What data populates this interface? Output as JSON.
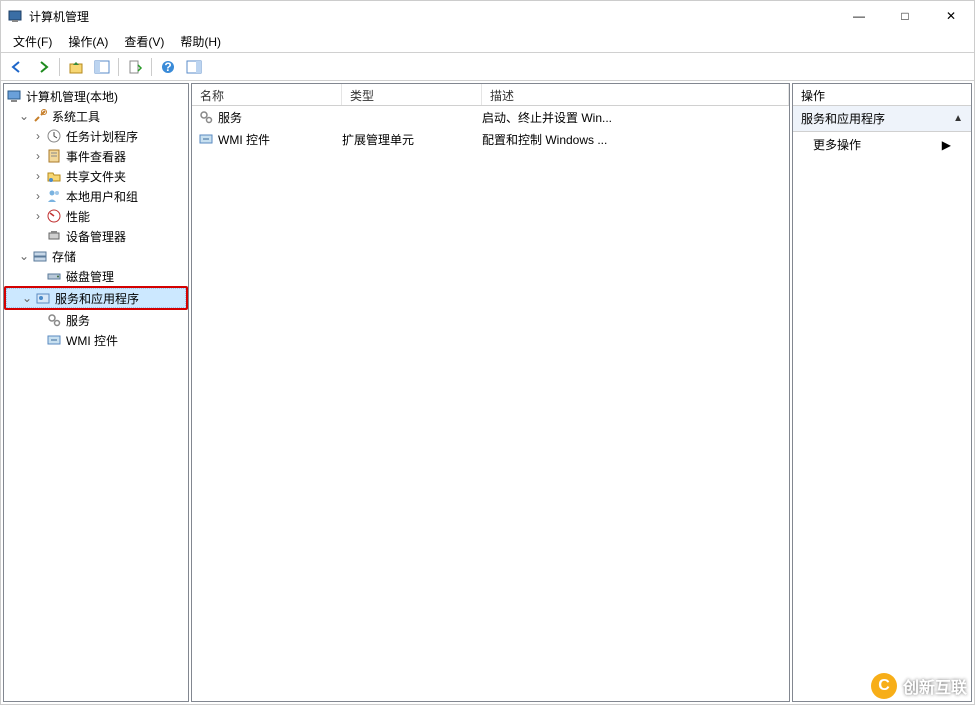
{
  "window": {
    "title": "计算机管理",
    "minimize": "—",
    "maximize": "□",
    "close": "✕"
  },
  "menu": {
    "file": "文件(F)",
    "action": "操作(A)",
    "view": "查看(V)",
    "help": "帮助(H)"
  },
  "tree": {
    "root": "计算机管理(本地)",
    "system_tools": "系统工具",
    "task_scheduler": "任务计划程序",
    "event_viewer": "事件查看器",
    "shared_folders": "共享文件夹",
    "local_users": "本地用户和组",
    "performance": "性能",
    "device_manager": "设备管理器",
    "storage": "存储",
    "disk_management": "磁盘管理",
    "services_apps": "服务和应用程序",
    "services": "服务",
    "wmi_control": "WMI 控件"
  },
  "list": {
    "columns": {
      "name": "名称",
      "type": "类型",
      "description": "描述"
    },
    "rows": [
      {
        "name": "服务",
        "type": "",
        "description": "启动、终止并设置 Win..."
      },
      {
        "name": "WMI 控件",
        "type": "扩展管理单元",
        "description": "配置和控制 Windows ..."
      }
    ]
  },
  "actions": {
    "header": "操作",
    "context": "服务和应用程序",
    "more": "更多操作"
  },
  "watermark": "创新互联"
}
